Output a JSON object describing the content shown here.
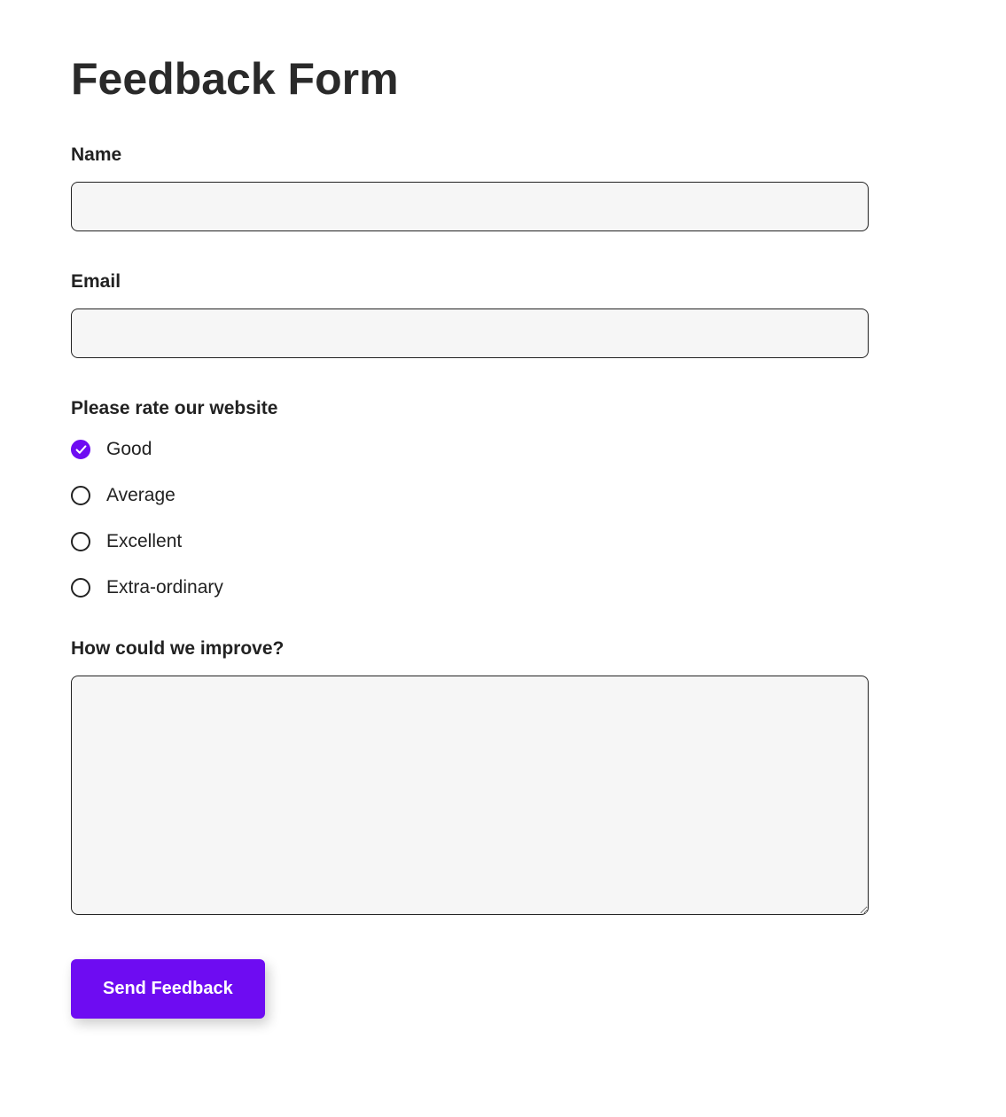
{
  "form": {
    "title": "Feedback Form",
    "name_label": "Name",
    "name_value": "",
    "email_label": "Email",
    "email_value": "",
    "rating_question": "Please rate our website",
    "rating_options": [
      {
        "label": "Good",
        "selected": true
      },
      {
        "label": "Average",
        "selected": false
      },
      {
        "label": "Excellent",
        "selected": false
      },
      {
        "label": "Extra-ordinary",
        "selected": false
      }
    ],
    "improve_label": "How could we improve?",
    "improve_value": "",
    "submit_label": "Send Feedback"
  },
  "colors": {
    "accent": "#6e0cf2"
  }
}
